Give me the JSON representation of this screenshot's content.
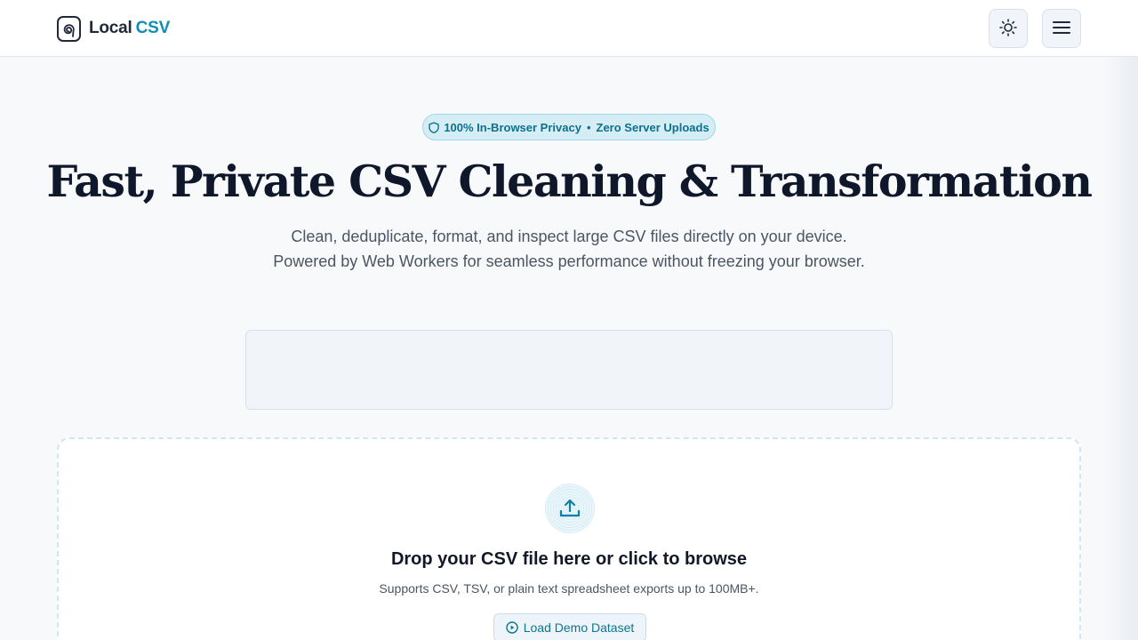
{
  "header": {
    "logo_text": "Local",
    "logo_accent": "CSV",
    "logo_icon": "spiral-logo-icon",
    "theme_icon": "sun-icon",
    "menu_icon": "hamburger-menu-icon"
  },
  "hero": {
    "badge_left": "100% In-Browser Privacy",
    "badge_sep": "•",
    "badge_right": "Zero Server Uploads",
    "title": "Fast, Private CSV Cleaning & Transformation",
    "subtitle_line1": "Clean, deduplicate, format, and inspect large CSV files directly on your device.",
    "subtitle_line2": "Powered by Web Workers for seamless performance without freezing your browser."
  },
  "dropzone": {
    "title": "Drop your CSV file here or click to browse",
    "subtitle": "Supports CSV, TSV, or plain text spreadsheet exports up to 100MB+.",
    "demo_label": "Load Demo Dataset",
    "upload_icon": "upload-icon",
    "demo_icon": "play-circle-icon"
  },
  "colors": {
    "accent": "#0e8fb5",
    "badge_bg": "#d5eef6",
    "text_dark": "#0f172a"
  }
}
